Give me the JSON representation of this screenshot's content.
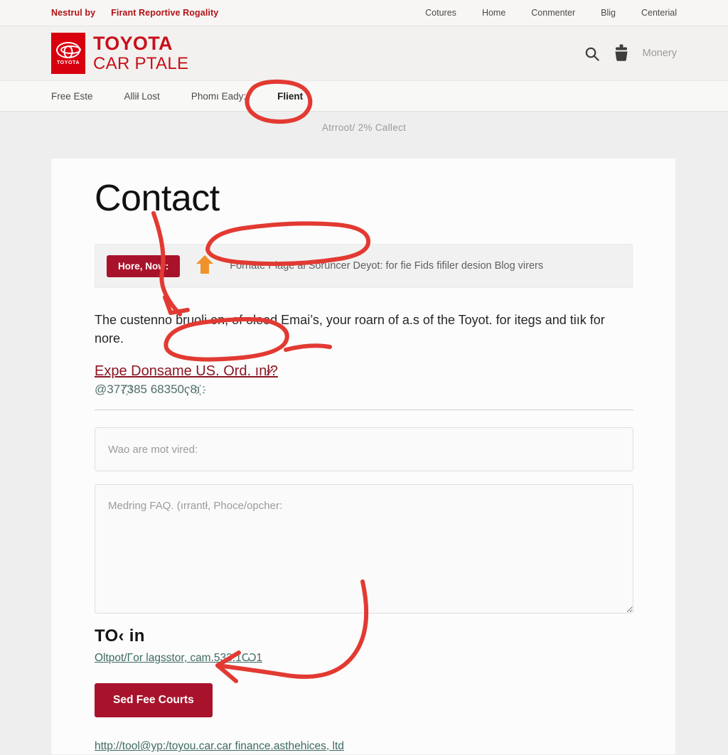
{
  "topbar": {
    "promo_left": "Nestrul by",
    "promo_right": "Firant Reportive Rogality",
    "links": [
      "Cotures",
      "Home",
      "Conmenter",
      "Blig",
      "Centerial"
    ]
  },
  "masthead": {
    "logo_badge": "TOYOTA",
    "brand_line1": "TOYOTA",
    "brand_line2": "CAR PTALE",
    "search_icon": "search-icon",
    "cart_icon": "cart-icon",
    "account_label": "Monery"
  },
  "mainnav": {
    "items": [
      {
        "label": "Free Este",
        "active": false
      },
      {
        "label": "Allił Lost",
        "active": false
      },
      {
        "label": "Phomı Eady:",
        "active": false
      },
      {
        "label": "Flient",
        "active": true
      }
    ]
  },
  "breadcrumb": "Atrroot/ 2% Callect",
  "main": {
    "title": "Contact",
    "alert": {
      "pill_label": "Hore, Now:",
      "arrow_icon": "up-arrow-icon",
      "message": "Fornate Plage al Soruncer Deyot: for fie Fids fifiler desion Blog virers"
    },
    "lead": "The custenno bruoli on, of oleed Emai’s, your roarn of a.s of the Toyot. for itegs and tiık for nore.",
    "request_link": "Expe Donѕame US. Ord. ınł̷?",
    "phone": "@377҉385 68350ҁ8ı҉",
    "name_input": {
      "placeholder": "Wao are mot vired:",
      "value": ""
    },
    "message_input": {
      "placeholder": "Medring FAQ. (ırrantł, Phoce/opcher:",
      "value": ""
    },
    "section_title": "TO‹ in",
    "section_link": "Oltpot/Γor lagsstor, cam.533.1Ѡ1",
    "submit_label": "Sed Fee Courts",
    "footer_link": "http://tool@yp:/toyou.car.car finance.asthehices, ltd"
  },
  "annotations": {
    "highlight_tab": "Flient",
    "circle_alert_message": true,
    "circle_request_link": true,
    "arrow_to_lead": true,
    "arrow_to_submit": true,
    "ink_color": "#e23a32"
  },
  "colors": {
    "brand_red": "#c8101a",
    "logo_red": "#d8000f",
    "button_red": "#a8132b",
    "annotation_red": "#e23a32",
    "page_bg": "#eeeeee",
    "card_bg": "#fcfcfc"
  }
}
